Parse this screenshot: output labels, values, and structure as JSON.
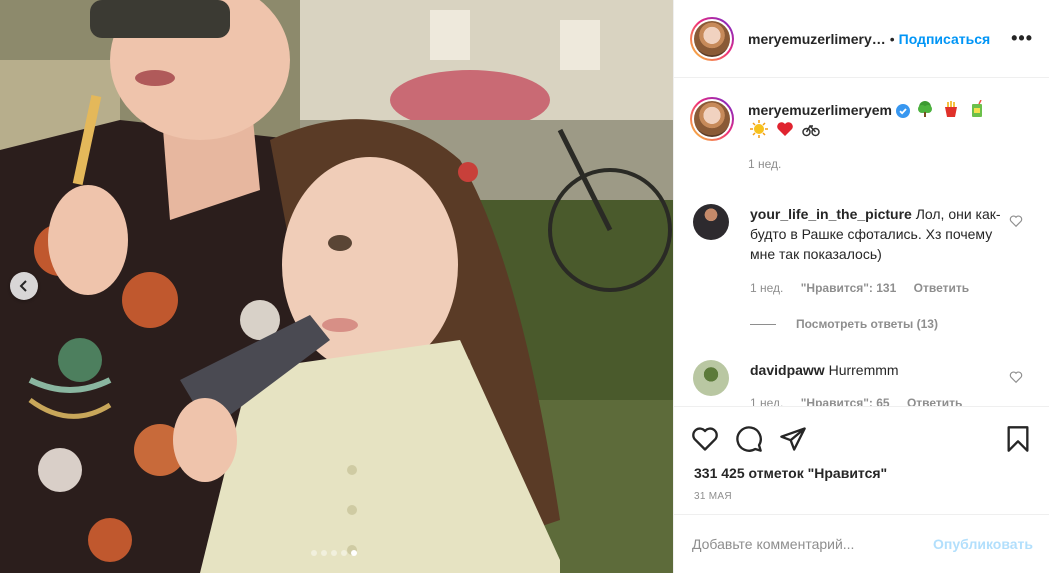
{
  "post": {
    "author": "meryemuzerlimeryem",
    "author_truncated": "meryemuzerlimery…",
    "separator": "•",
    "follow_label": "Подписаться",
    "more_label": "•••",
    "caption_emojis": [
      "tree-emoji",
      "fries-emoji",
      "juice-box-emoji",
      "sun-emoji",
      "heart-emoji",
      "bicycle-emoji"
    ],
    "caption_time": "1 нед.",
    "slides_total": 5,
    "slide_active": 5,
    "likes_text": "331 425 отметок \"Нравится\"",
    "date": "31 мая"
  },
  "comments": [
    {
      "username": "your_life_in_the_picture",
      "text": "Лол, они как-будто в Рашке сфотались. Хз почему мне так показалось)",
      "time": "1 нед.",
      "likes": "\"Нравится\": 131",
      "reply_label": "Ответить",
      "view_replies": "Посмотреть ответы (13)"
    },
    {
      "username": "davidpaww",
      "text": "Hurremmm",
      "time": "1 нед.",
      "likes": "\"Нравится\": 65",
      "reply_label": "Ответить"
    }
  ],
  "composer": {
    "placeholder": "Добавьте комментарий...",
    "post_label": "Опубликовать"
  },
  "colors": {
    "link_blue": "#0095f6",
    "post_disabled": "#b2dffc",
    "verified_blue": "#3897f0",
    "secondary_text": "#8e8e8e"
  }
}
